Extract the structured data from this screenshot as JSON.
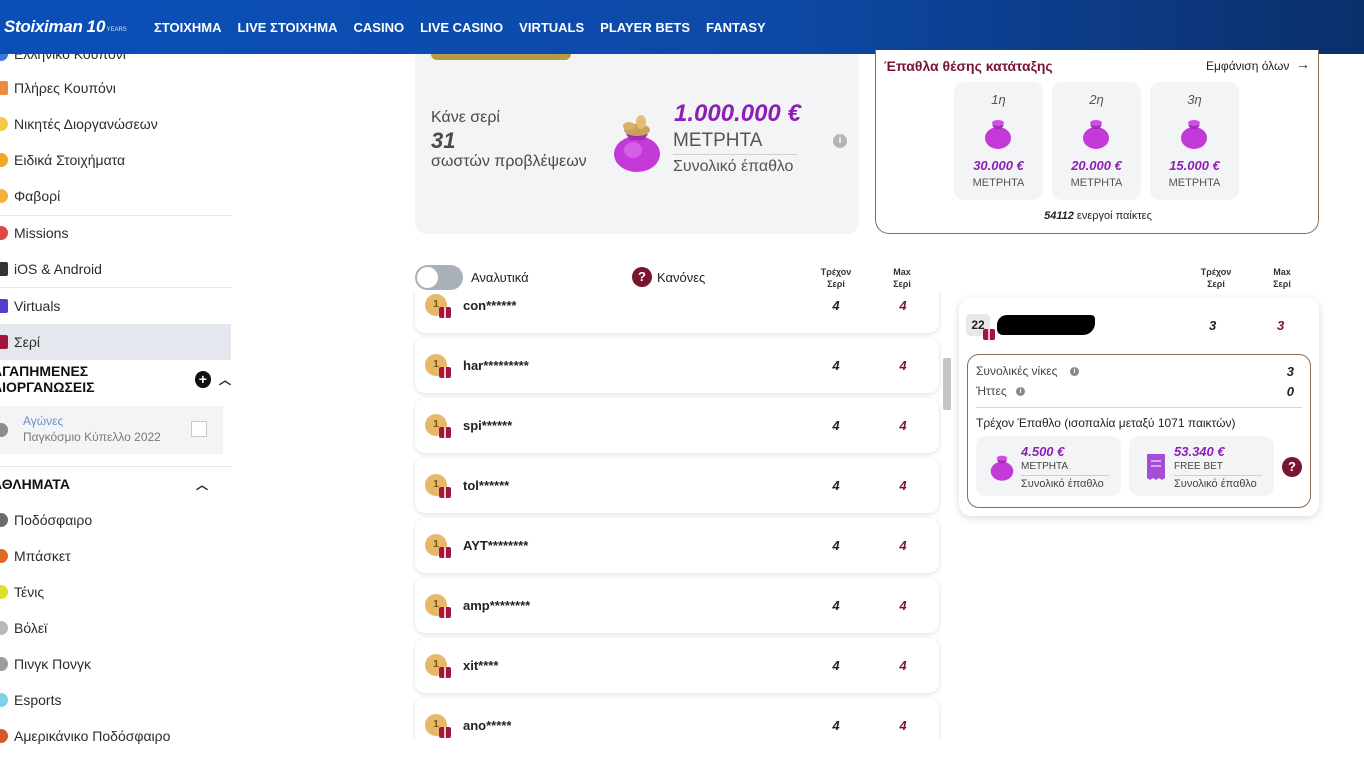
{
  "header": {
    "logo": "Stoiximan",
    "logo_badge": "10",
    "logo_sub": "YEARS",
    "nav": [
      "ΣΤΟΙΧΗΜΑ",
      "LIVE ΣΤΟΙΧΗΜΑ",
      "CASINO",
      "LIVE CASINO",
      "VIRTUALS",
      "PLAYER BETS",
      "FANTASY"
    ]
  },
  "sidebar": {
    "top_cut_label": "Ελληνικό Κουπόνι",
    "items": [
      {
        "label": "Πλήρες Κουπόνι",
        "icon": "coupon-icon"
      },
      {
        "label": "Νικητές Διοργανώσεων",
        "icon": "trophy-icon"
      },
      {
        "label": "Ειδικά Στοιχήματα",
        "icon": "special-icon"
      },
      {
        "label": "Φαβορί",
        "icon": "favorite-icon"
      },
      {
        "label": "Missions",
        "icon": "target-icon"
      },
      {
        "label": "iOS & Android",
        "icon": "mobile-icon"
      },
      {
        "label": "Virtuals",
        "icon": "virtuals-icon"
      },
      {
        "label": "Σερί",
        "icon": "streak-icon"
      }
    ],
    "favorites_section": "ΑΓΑΠΗΜΕΝΕΣ ΔΙΟΡΓΑΝΩΣΕΙΣ",
    "favorite": {
      "sport": "Αγώνες",
      "competition": "Παγκόσμιο Κύπελλο 2022"
    },
    "sports_section": "ΑΘΛΗΜΑΤΑ",
    "sports": [
      {
        "label": "Ποδόσφαιρο",
        "icon": "football-icon"
      },
      {
        "label": "Μπάσκετ",
        "icon": "basketball-icon"
      },
      {
        "label": "Τένις",
        "icon": "tennis-icon"
      },
      {
        "label": "Βόλεϊ",
        "icon": "volleyball-icon"
      },
      {
        "label": "Πινγκ Πονγκ",
        "icon": "pingpong-icon"
      },
      {
        "label": "Esports",
        "icon": "esports-icon"
      },
      {
        "label": "Αμερικάνικο Ποδόσφαιρο",
        "icon": "american-football-icon"
      }
    ]
  },
  "streak": {
    "line1": "Κάνε σερί",
    "count": "31",
    "line3": "σωστών προβλέψεων",
    "amount": "1.000.000 €",
    "cash": "ΜΕΤΡΗΤΑ",
    "total": "Συνολικό έπαθλο"
  },
  "leaderboard_prizes": {
    "title": "Έπαθλα θέσης κατάταξης",
    "show_all": "Εμφάνιση όλων",
    "prizes": [
      {
        "rank": "1η",
        "amount": "30.000 €",
        "type": "ΜΕΤΡΗΤΑ"
      },
      {
        "rank": "2η",
        "amount": "20.000 €",
        "type": "ΜΕΤΡΗΤΑ"
      },
      {
        "rank": "3η",
        "amount": "15.000 €",
        "type": "ΜΕΤΡΗΤΑ"
      }
    ],
    "active_count": "54112",
    "active_label": "ενεργοί παίκτες"
  },
  "controls": {
    "toggle_label": "Αναλυτικά",
    "rules_label": "Κανόνες",
    "col_current": "Τρέχον Σερί",
    "col_max": "Max Σερί",
    "col_current_l1": "Τρέχον",
    "col_current_l2": "Σερί",
    "col_max_l1": "Max",
    "col_max_l2": "Σερί"
  },
  "leaderboard": [
    {
      "rank": "1",
      "name": "con******",
      "current": "4",
      "max": "4"
    },
    {
      "rank": "1",
      "name": "har*********",
      "current": "4",
      "max": "4"
    },
    {
      "rank": "1",
      "name": "spi******",
      "current": "4",
      "max": "4"
    },
    {
      "rank": "1",
      "name": "tol******",
      "current": "4",
      "max": "4"
    },
    {
      "rank": "1",
      "name": "ΑΥΤ********",
      "current": "4",
      "max": "4"
    },
    {
      "rank": "1",
      "name": "amp********",
      "current": "4",
      "max": "4"
    },
    {
      "rank": "1",
      "name": "xit****",
      "current": "4",
      "max": "4"
    },
    {
      "rank": "1",
      "name": "ano*****",
      "current": "4",
      "max": "4"
    }
  ],
  "player": {
    "rank": "22",
    "current": "3",
    "max": "3",
    "total_wins_label": "Συνολικές νίκες",
    "total_wins": "3",
    "losses_label": "Ήττες",
    "losses": "0",
    "current_prize": "Τρέχον Έπαθλο (ισοπαλία μεταξύ 1071 παικτών)",
    "cash_amount": "4.500 €",
    "cash_type": "ΜΕΤΡΗΤΑ",
    "cash_total": "Συνολικό έπαθλο",
    "freebet_amount": "53.340 €",
    "freebet_type": "FREE BET",
    "freebet_total": "Συνολικό έπαθλο"
  },
  "colors": {
    "brand_blue": "#0a4fb8",
    "accent_purple": "#8c1fb6",
    "accent_maroon": "#7a1530"
  }
}
